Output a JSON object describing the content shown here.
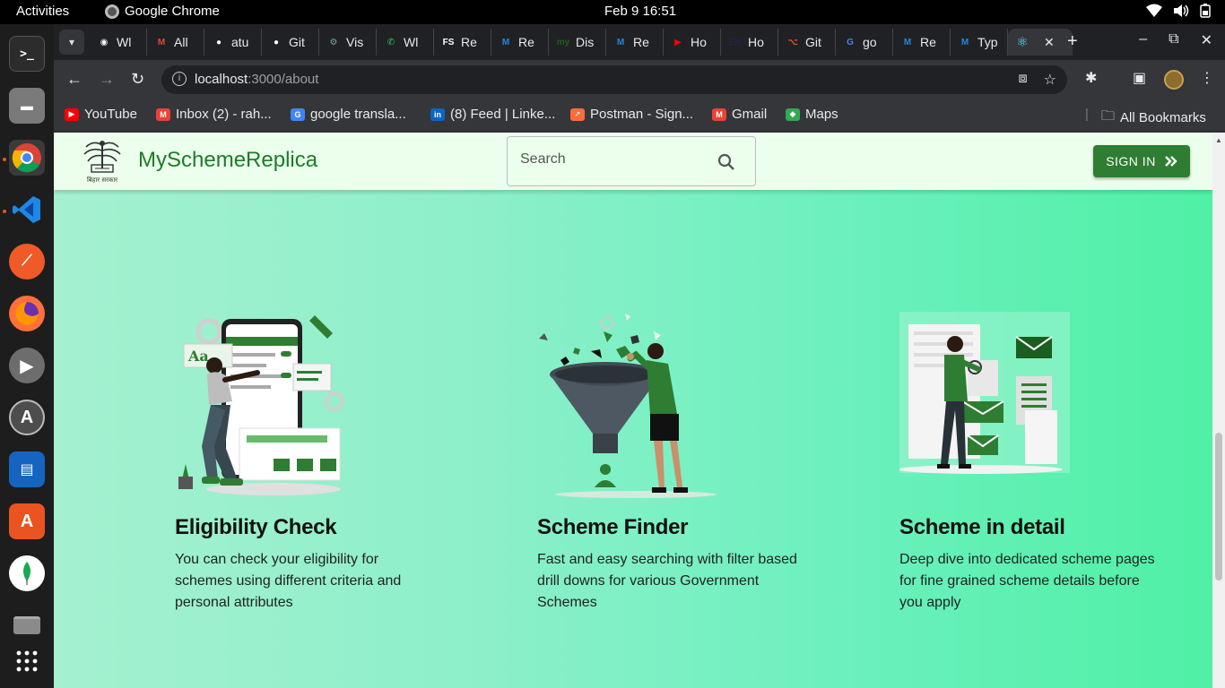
{
  "os": {
    "activities": "Activities",
    "app_name": "Google Chrome",
    "clock": "Feb 9  16:51"
  },
  "browser": {
    "tabs": [
      {
        "label": "Wl",
        "icon": "chrome-icon",
        "color": "#ffffff"
      },
      {
        "label": "All",
        "icon": "gmail-icon",
        "color": "#ea4335"
      },
      {
        "label": "atu",
        "icon": "github-icon",
        "color": "#ffffff"
      },
      {
        "label": "Git",
        "icon": "github-icon",
        "color": "#ffffff"
      },
      {
        "label": "Vis",
        "icon": "openai-icon",
        "color": "#74aa9c"
      },
      {
        "label": "Wl",
        "icon": "whatsapp-icon",
        "color": "#25d366"
      },
      {
        "label": "Re",
        "icon": "fs-icon",
        "color": "#ffffff"
      },
      {
        "label": "Re",
        "icon": "mui-icon",
        "color": "#1e88e5"
      },
      {
        "label": "Dis",
        "icon": "my-icon",
        "color": "#1b5e20"
      },
      {
        "label": "Re",
        "icon": "mui-icon",
        "color": "#1e88e5"
      },
      {
        "label": "Ho",
        "icon": "youtube-icon",
        "color": "#ff0000"
      },
      {
        "label": "Ho",
        "icon": "em-icon",
        "color": "#222244"
      },
      {
        "label": "Git",
        "icon": "git-icon",
        "color": "#f05033"
      },
      {
        "label": "go",
        "icon": "google-icon",
        "color": "#4285f4"
      },
      {
        "label": "Re",
        "icon": "mui-icon",
        "color": "#1e88e5"
      },
      {
        "label": "Typ",
        "icon": "mui-icon",
        "color": "#1e88e5"
      }
    ],
    "active_tab_icon": "react-icon",
    "url_host": "localhost",
    "url_path": ":3000/about",
    "bookmarks": [
      {
        "label": "YouTube",
        "icon": "youtube-icon",
        "color": "#ff0000"
      },
      {
        "label": "Inbox (2) - rah...",
        "icon": "gmail-icon",
        "color": "#ea4335"
      },
      {
        "label": "google transla...",
        "icon": "google-icon",
        "color": "#4285f4"
      },
      {
        "label": "(8) Feed | Linke...",
        "icon": "linkedin-icon",
        "color": "#0a66c2"
      },
      {
        "label": "Postman - Sign...",
        "icon": "postman-icon",
        "color": "#ff6c37"
      },
      {
        "label": "Gmail",
        "icon": "gmail-icon",
        "color": "#ea4335"
      },
      {
        "label": "Maps",
        "icon": "maps-icon",
        "color": "#34a853"
      }
    ],
    "all_bookmarks": "All Bookmarks"
  },
  "site": {
    "brand": "MySchemeReplica",
    "emblem_caption": "बिहार सरकार",
    "search_placeholder": "Search",
    "signin_label": "SIGN IN",
    "accent": "#2e7d32"
  },
  "features": [
    {
      "title": "Eligibility Check",
      "description": "You can check your eligibility for schemes using different criteria and personal attributes",
      "illustration": "person-customizing-phone-illustration"
    },
    {
      "title": "Scheme Finder",
      "description": "Fast and easy searching with filter based drill downs for various Government Schemes",
      "illustration": "person-with-funnel-illustration"
    },
    {
      "title": "Scheme in detail",
      "description": "Deep dive into dedicated scheme pages for fine grained scheme details before you apply",
      "illustration": "person-reading-documents-illustration"
    }
  ]
}
